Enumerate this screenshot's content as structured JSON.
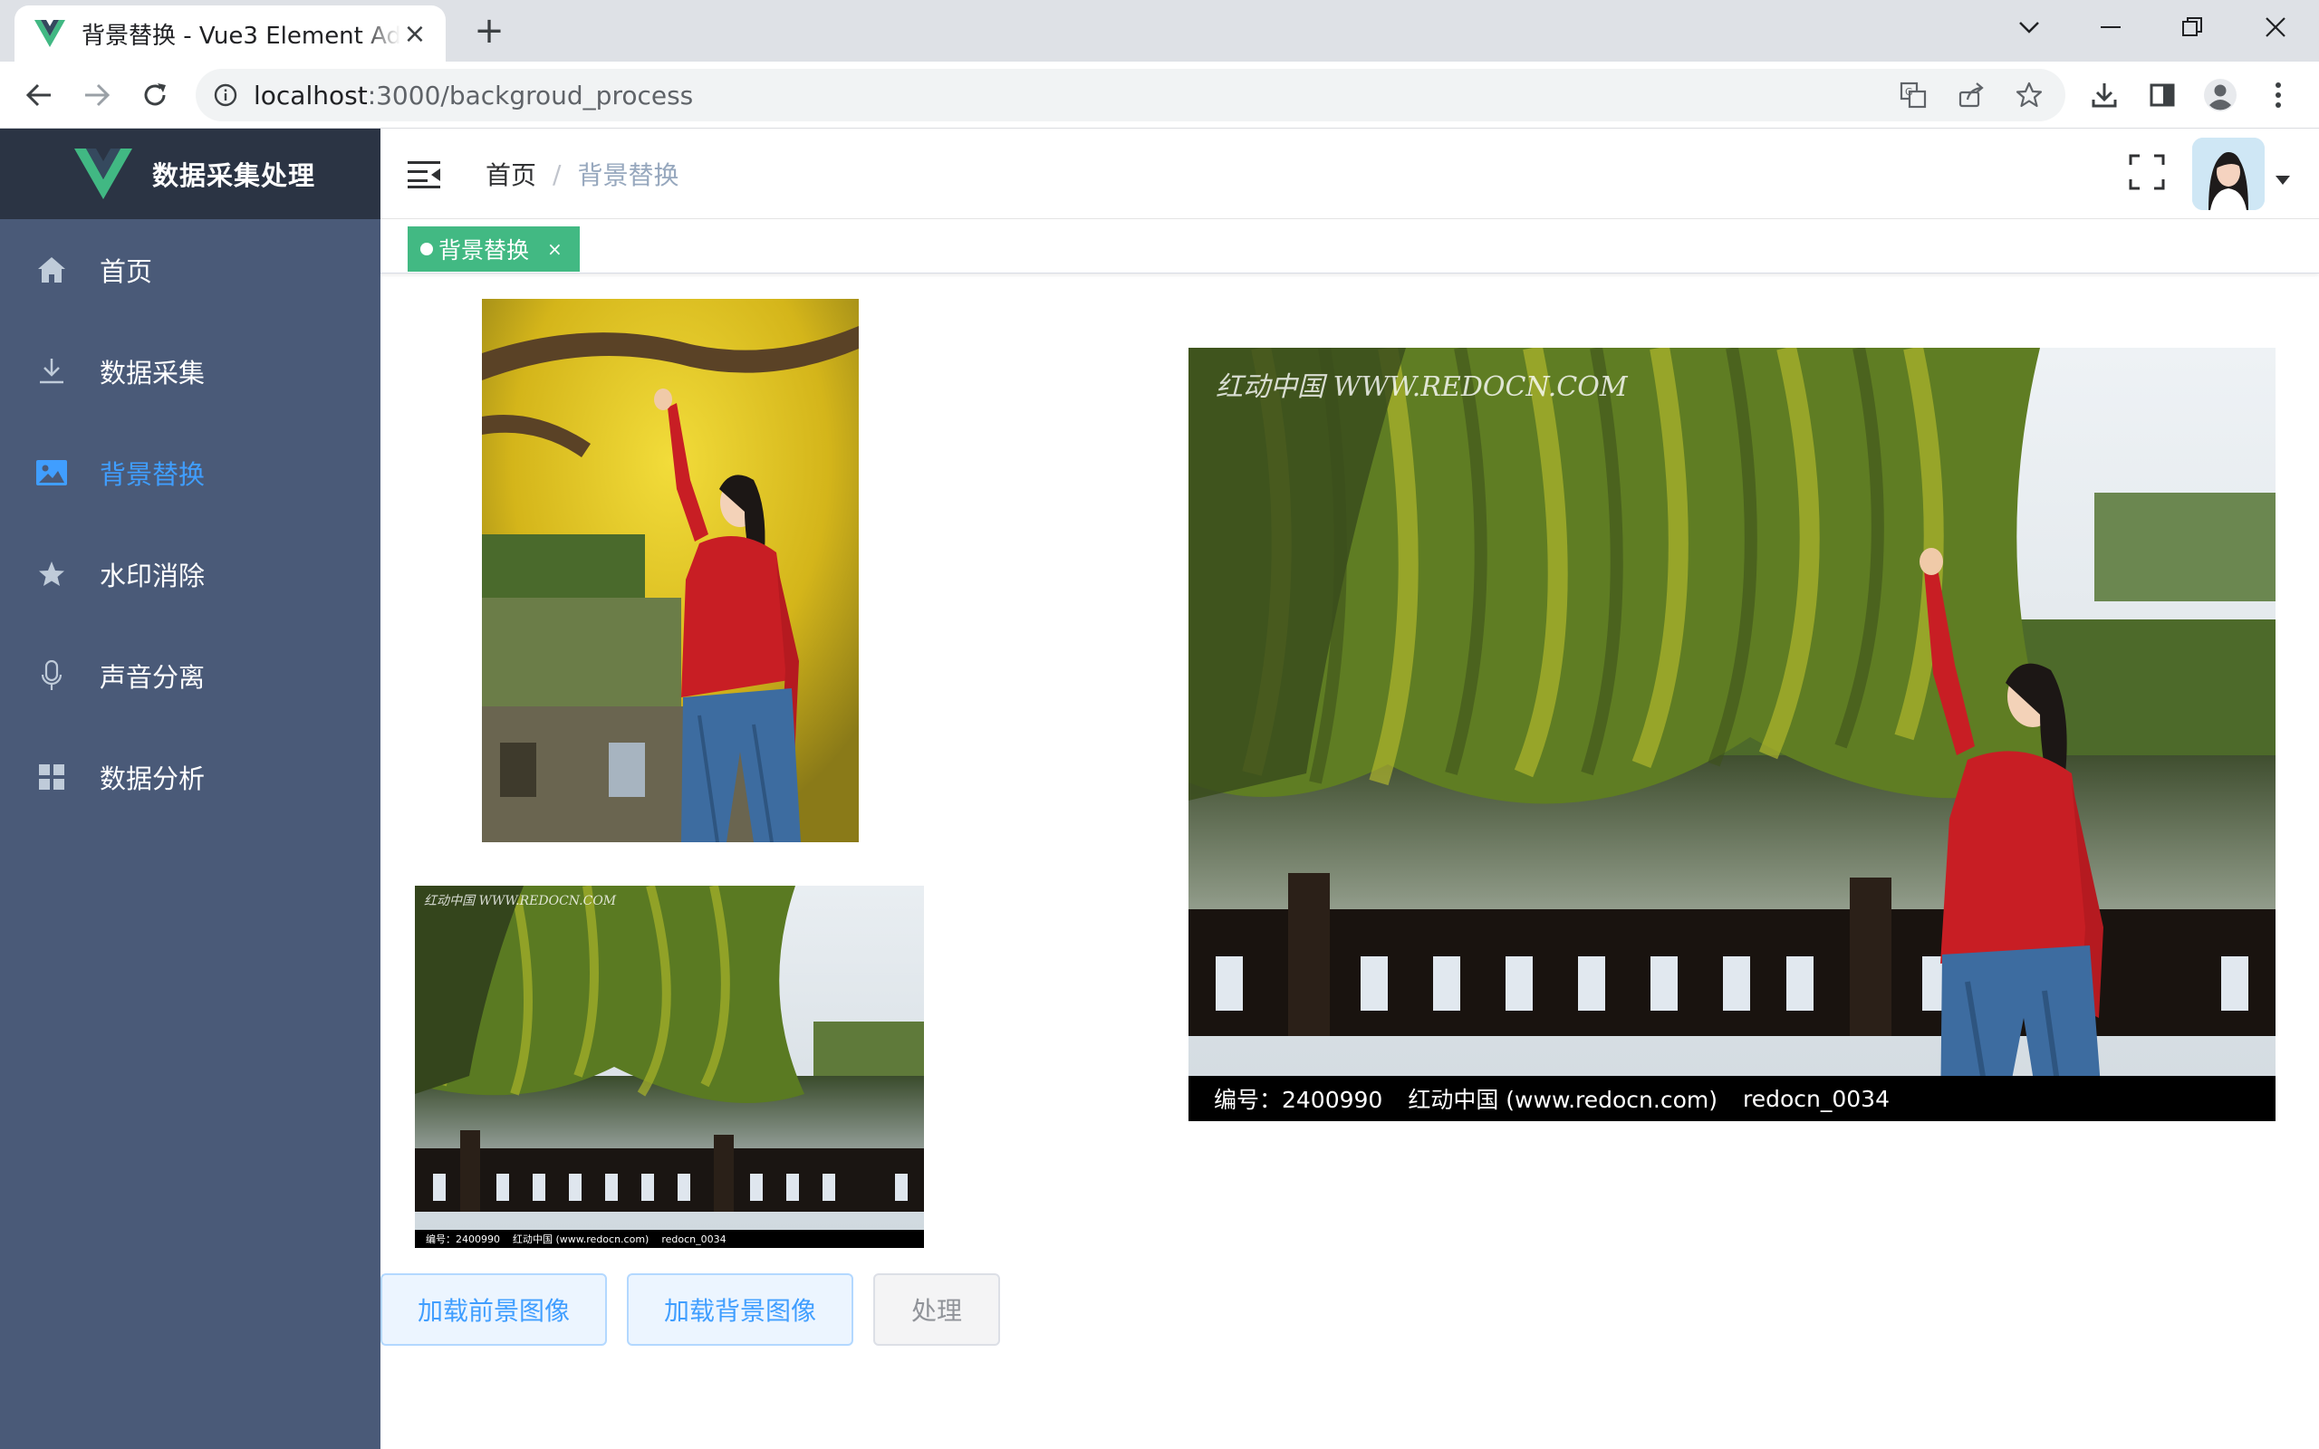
{
  "browser": {
    "tab_title": "背景替换 - Vue3 Element Admin",
    "tab_close": "×",
    "new_tab": "+",
    "url_host": "localhost",
    "url_rest": ":3000/backgroud_process"
  },
  "sidebar": {
    "brand": "数据采集处理",
    "items": [
      {
        "label": "首页",
        "icon": "home-icon",
        "active": false
      },
      {
        "label": "数据采集",
        "icon": "download-icon",
        "active": false
      },
      {
        "label": "背景替换",
        "icon": "picture-icon",
        "active": true
      },
      {
        "label": "水印消除",
        "icon": "star-icon",
        "active": false
      },
      {
        "label": "声音分离",
        "icon": "microphone-icon",
        "active": false
      },
      {
        "label": "数据分析",
        "icon": "grid-icon",
        "active": false
      }
    ]
  },
  "navbar": {
    "breadcrumb_home": "首页",
    "breadcrumb_separator": "/",
    "breadcrumb_current": "背景替换"
  },
  "tags": {
    "active_tag": "背景替换",
    "close": "×"
  },
  "images": {
    "watermark_top": "红动中国 WWW.REDOCN.COM",
    "watermark_top_small": "红动中国 WWW.REDOCN.COM",
    "watermark_id": "编号：2400990",
    "watermark_site": "红动中国 (www.redocn.com)",
    "watermark_code": "redocn_0034"
  },
  "buttons": {
    "load_foreground": "加载前景图像",
    "load_background": "加载背景图像",
    "process": "处理"
  },
  "colors": {
    "sidebar_bg": "#4a5a78",
    "logo_bg": "#2b3444",
    "accent": "#409eff",
    "tag_green": "#42b983"
  }
}
